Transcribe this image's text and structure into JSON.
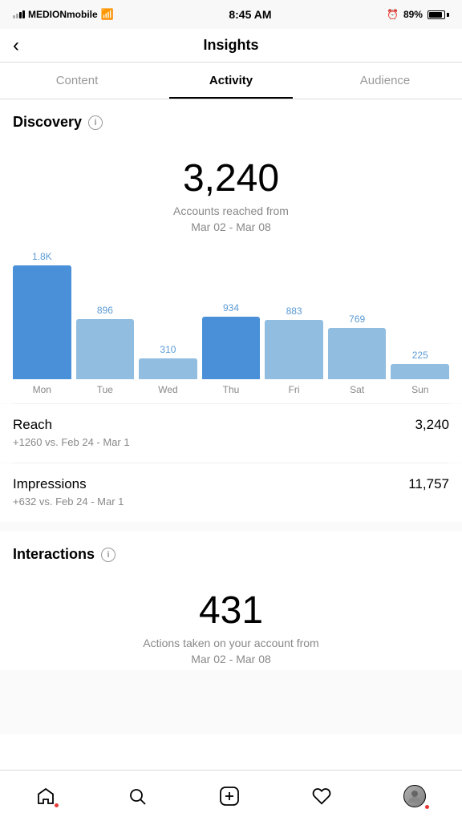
{
  "statusBar": {
    "carrier": "MEDIONmobile",
    "time": "8:45 AM",
    "battery": "89%"
  },
  "header": {
    "backLabel": "‹",
    "title": "Insights"
  },
  "tabs": [
    {
      "id": "content",
      "label": "Content",
      "active": false
    },
    {
      "id": "activity",
      "label": "Activity",
      "active": true
    },
    {
      "id": "audience",
      "label": "Audience",
      "active": false
    }
  ],
  "discovery": {
    "sectionTitle": "Discovery",
    "bigNumber": "3,240",
    "bigSubtitle": "Accounts reached from\nMar 02 - Mar 08",
    "chart": {
      "bars": [
        {
          "day": "Mon",
          "value": 1800,
          "label": "1.8K",
          "colorDark": true
        },
        {
          "day": "Tue",
          "value": 896,
          "label": "896",
          "colorDark": false
        },
        {
          "day": "Wed",
          "value": 310,
          "label": "310",
          "colorDark": false
        },
        {
          "day": "Thu",
          "value": 934,
          "label": "934",
          "colorDark": true
        },
        {
          "day": "Fri",
          "value": 883,
          "label": "883",
          "colorDark": false
        },
        {
          "day": "Sat",
          "value": 769,
          "label": "769",
          "colorDark": false
        },
        {
          "day": "Sun",
          "value": 225,
          "label": "225",
          "colorDark": false
        }
      ],
      "maxValue": 1800
    },
    "reach": {
      "label": "Reach",
      "value": "3,240",
      "change": "+1260 vs. Feb 24 - Mar 1"
    },
    "impressions": {
      "label": "Impressions",
      "value": "11,757",
      "change": "+632 vs. Feb 24 - Mar 1"
    }
  },
  "interactions": {
    "sectionTitle": "Interactions",
    "bigNumber": "431",
    "bigSubtitle": "Actions taken on your account from\nMar 02 - Mar 08"
  },
  "bottomNav": {
    "items": [
      {
        "id": "home",
        "icon": "⌂",
        "hasDot": true
      },
      {
        "id": "search",
        "icon": "○",
        "hasDot": false
      },
      {
        "id": "add",
        "icon": "⊕",
        "hasDot": false
      },
      {
        "id": "heart",
        "icon": "♡",
        "hasDot": false
      },
      {
        "id": "profile",
        "icon": "👤",
        "hasDot": true
      }
    ]
  }
}
